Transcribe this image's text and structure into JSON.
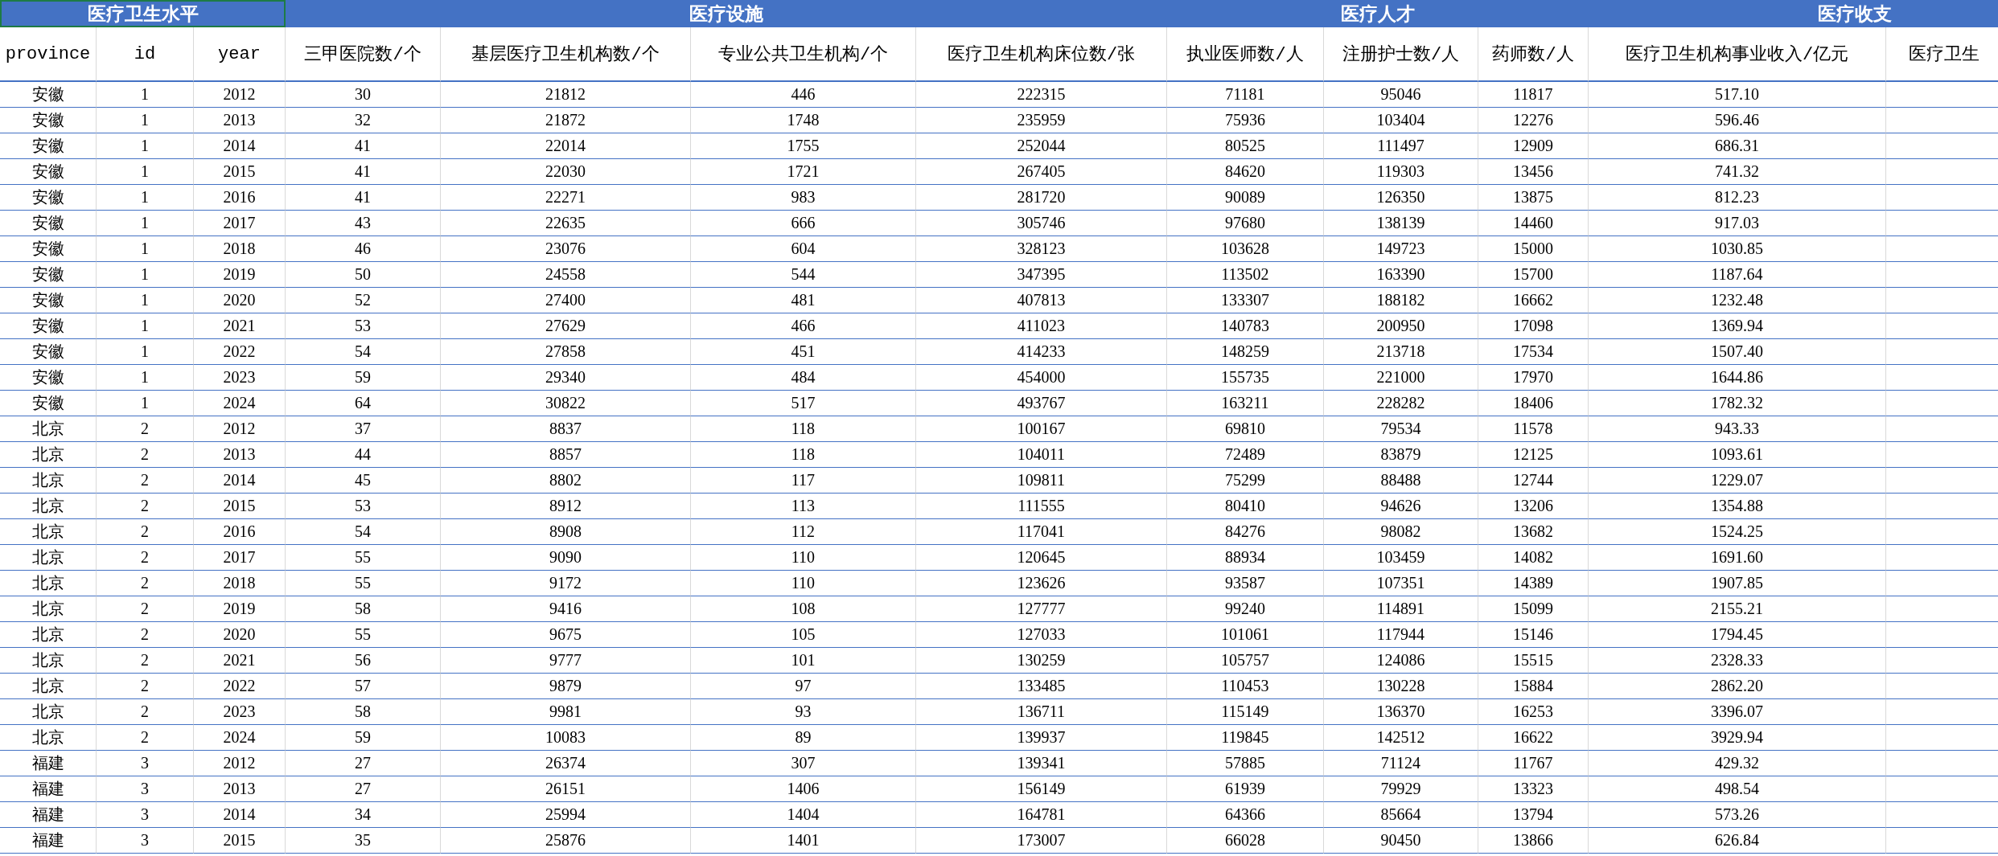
{
  "groups": [
    {
      "title": "医疗卫生水平",
      "selected": true,
      "columns": [
        "province",
        "id",
        "year"
      ]
    },
    {
      "title": "医疗设施",
      "selected": false,
      "columns": [
        "三甲医院数/个",
        "基层医疗卫生机构数/个",
        "专业公共卫生机构/个",
        "医疗卫生机构床位数/张"
      ]
    },
    {
      "title": "医疗人才",
      "selected": false,
      "columns": [
        "执业医师数/人",
        "注册护士数/人",
        "药师数/人"
      ]
    },
    {
      "title": "医疗收支",
      "selected": false,
      "columns": [
        "医疗卫生机构事业收入/亿元",
        "医疗卫生"
      ]
    }
  ],
  "rows": [
    [
      "安徽",
      "1",
      "2012",
      "30",
      "21812",
      "446",
      "222315",
      "71181",
      "95046",
      "11817",
      "517.10"
    ],
    [
      "安徽",
      "1",
      "2013",
      "32",
      "21872",
      "1748",
      "235959",
      "75936",
      "103404",
      "12276",
      "596.46"
    ],
    [
      "安徽",
      "1",
      "2014",
      "41",
      "22014",
      "1755",
      "252044",
      "80525",
      "111497",
      "12909",
      "686.31"
    ],
    [
      "安徽",
      "1",
      "2015",
      "41",
      "22030",
      "1721",
      "267405",
      "84620",
      "119303",
      "13456",
      "741.32"
    ],
    [
      "安徽",
      "1",
      "2016",
      "41",
      "22271",
      "983",
      "281720",
      "90089",
      "126350",
      "13875",
      "812.23"
    ],
    [
      "安徽",
      "1",
      "2017",
      "43",
      "22635",
      "666",
      "305746",
      "97680",
      "138139",
      "14460",
      "917.03"
    ],
    [
      "安徽",
      "1",
      "2018",
      "46",
      "23076",
      "604",
      "328123",
      "103628",
      "149723",
      "15000",
      "1030.85"
    ],
    [
      "安徽",
      "1",
      "2019",
      "50",
      "24558",
      "544",
      "347395",
      "113502",
      "163390",
      "15700",
      "1187.64"
    ],
    [
      "安徽",
      "1",
      "2020",
      "52",
      "27400",
      "481",
      "407813",
      "133307",
      "188182",
      "16662",
      "1232.48"
    ],
    [
      "安徽",
      "1",
      "2021",
      "53",
      "27629",
      "466",
      "411023",
      "140783",
      "200950",
      "17098",
      "1369.94"
    ],
    [
      "安徽",
      "1",
      "2022",
      "54",
      "27858",
      "451",
      "414233",
      "148259",
      "213718",
      "17534",
      "1507.40"
    ],
    [
      "安徽",
      "1",
      "2023",
      "59",
      "29340",
      "484",
      "454000",
      "155735",
      "221000",
      "17970",
      "1644.86"
    ],
    [
      "安徽",
      "1",
      "2024",
      "64",
      "30822",
      "517",
      "493767",
      "163211",
      "228282",
      "18406",
      "1782.32"
    ],
    [
      "北京",
      "2",
      "2012",
      "37",
      "8837",
      "118",
      "100167",
      "69810",
      "79534",
      "11578",
      "943.33"
    ],
    [
      "北京",
      "2",
      "2013",
      "44",
      "8857",
      "118",
      "104011",
      "72489",
      "83879",
      "12125",
      "1093.61"
    ],
    [
      "北京",
      "2",
      "2014",
      "45",
      "8802",
      "117",
      "109811",
      "75299",
      "88488",
      "12744",
      "1229.07"
    ],
    [
      "北京",
      "2",
      "2015",
      "53",
      "8912",
      "113",
      "111555",
      "80410",
      "94626",
      "13206",
      "1354.88"
    ],
    [
      "北京",
      "2",
      "2016",
      "54",
      "8908",
      "112",
      "117041",
      "84276",
      "98082",
      "13682",
      "1524.25"
    ],
    [
      "北京",
      "2",
      "2017",
      "55",
      "9090",
      "110",
      "120645",
      "88934",
      "103459",
      "14082",
      "1691.60"
    ],
    [
      "北京",
      "2",
      "2018",
      "55",
      "9172",
      "110",
      "123626",
      "93587",
      "107351",
      "14389",
      "1907.85"
    ],
    [
      "北京",
      "2",
      "2019",
      "58",
      "9416",
      "108",
      "127777",
      "99240",
      "114891",
      "15099",
      "2155.21"
    ],
    [
      "北京",
      "2",
      "2020",
      "55",
      "9675",
      "105",
      "127033",
      "101061",
      "117944",
      "15146",
      "1794.45"
    ],
    [
      "北京",
      "2",
      "2021",
      "56",
      "9777",
      "101",
      "130259",
      "105757",
      "124086",
      "15515",
      "2328.33"
    ],
    [
      "北京",
      "2",
      "2022",
      "57",
      "9879",
      "97",
      "133485",
      "110453",
      "130228",
      "15884",
      "2862.20"
    ],
    [
      "北京",
      "2",
      "2023",
      "58",
      "9981",
      "93",
      "136711",
      "115149",
      "136370",
      "16253",
      "3396.07"
    ],
    [
      "北京",
      "2",
      "2024",
      "59",
      "10083",
      "89",
      "139937",
      "119845",
      "142512",
      "16622",
      "3929.94"
    ],
    [
      "福建",
      "3",
      "2012",
      "27",
      "26374",
      "307",
      "139341",
      "57885",
      "71124",
      "11767",
      "429.32"
    ],
    [
      "福建",
      "3",
      "2013",
      "27",
      "26151",
      "1406",
      "156149",
      "61939",
      "79929",
      "13323",
      "498.54"
    ],
    [
      "福建",
      "3",
      "2014",
      "34",
      "25994",
      "1404",
      "164781",
      "64366",
      "85664",
      "13794",
      "573.26"
    ],
    [
      "福建",
      "3",
      "2015",
      "35",
      "25876",
      "1401",
      "173007",
      "66028",
      "90450",
      "13866",
      "626.84"
    ]
  ]
}
